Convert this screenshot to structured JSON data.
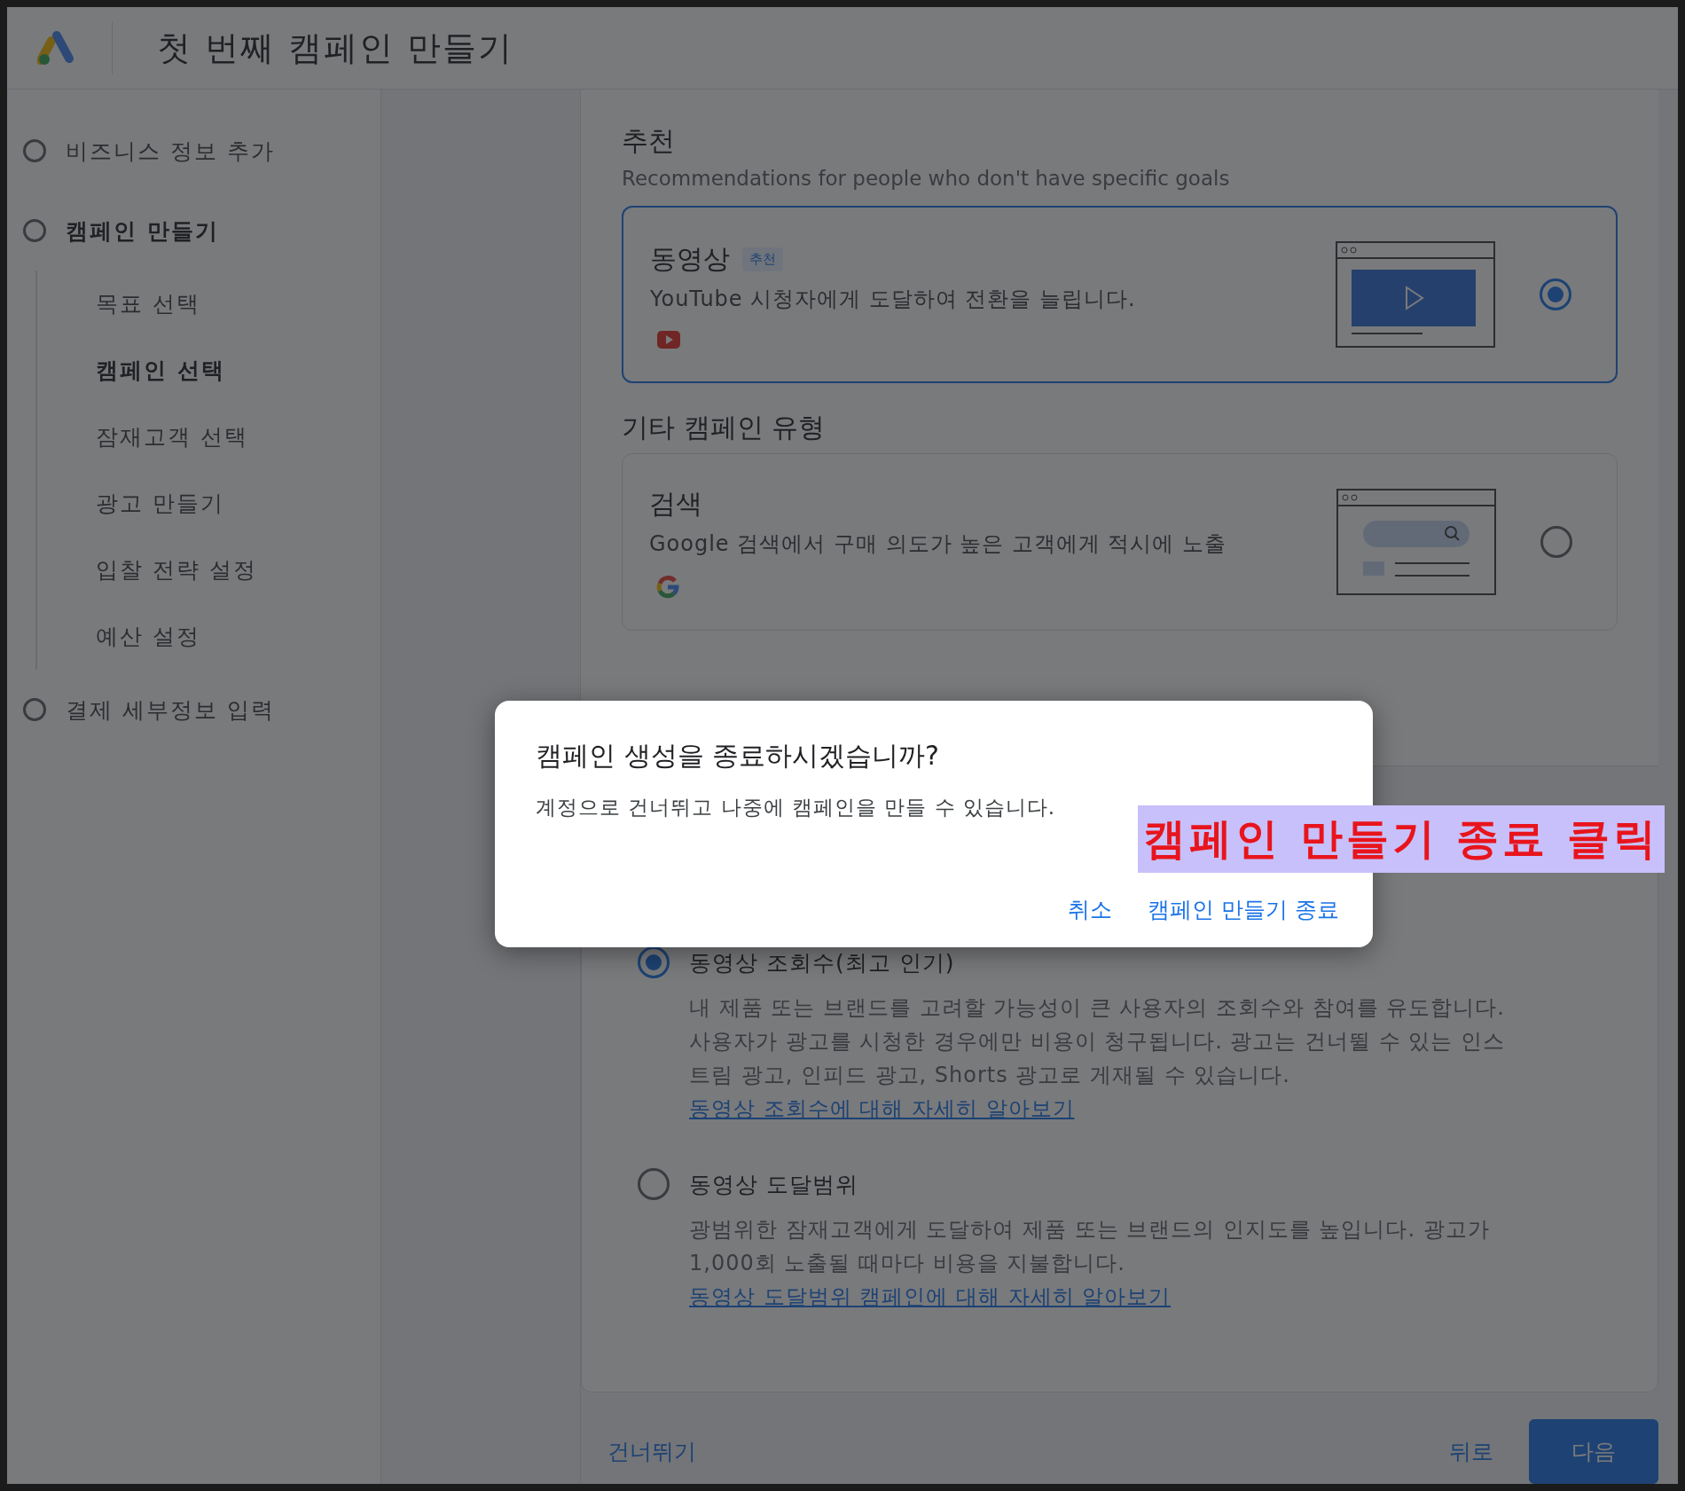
{
  "header": {
    "title": "첫 번째 캠페인 만들기"
  },
  "steps": [
    {
      "label": "비즈니스 정보 추가",
      "selected": false
    },
    {
      "label": "캠페인 만들기",
      "selected": true,
      "children": [
        {
          "label": "목표 선택",
          "selected": false
        },
        {
          "label": "캠페인 선택",
          "selected": true
        },
        {
          "label": "잠재고객 선택",
          "selected": false
        },
        {
          "label": "광고 만들기",
          "selected": false
        },
        {
          "label": "입찰 전략 설정",
          "selected": false
        },
        {
          "label": "예산 설정",
          "selected": false
        }
      ]
    },
    {
      "label": "결제 세부정보 입력",
      "selected": false
    }
  ],
  "recommended": {
    "heading": "추천",
    "subheading": "Recommendations for people who don't have specific goals",
    "cards": [
      {
        "kind": "video",
        "title": "동영상",
        "badge": "추천",
        "description": "YouTube 시청자에게 도달하여 전환을 늘립니다.",
        "selected": true
      }
    ]
  },
  "other": {
    "heading": "기타 캠페인 유형",
    "cards": [
      {
        "kind": "search",
        "title": "검색",
        "description": "Google 검색에서 구매 의도가 높은 고객에게 적시에 노출",
        "selected": false
      }
    ]
  },
  "subtypes": {
    "options": [
      {
        "label": "동영상 조회수(최고 인기)",
        "selected": true,
        "description": "내 제품 또는 브랜드를 고려할 가능성이 큰 사용자의 조회수와 참여를 유도합니다. 사용자가 광고를 시청한 경우에만 비용이 청구됩니다. 광고는 건너뛸 수 있는 인스트림 광고, 인피드 광고, Shorts 광고로 게재될 수 있습니다.",
        "link": "동영상 조회수에 대해 자세히 알아보기"
      },
      {
        "label": "동영상 도달범위",
        "selected": false,
        "description": "광범위한 잠재고객에게 도달하여 제품 또는 브랜드의 인지도를 높입니다. 광고가 1,000회 노출될 때마다 비용을 지불합니다.",
        "link": "동영상 도달범위 캠페인에 대해 자세히 알아보기"
      }
    ]
  },
  "footer": {
    "skip": "건너뛰기",
    "back": "뒤로",
    "next": "다음"
  },
  "dialog": {
    "title": "캠페인 생성을 종료하시겠습니까?",
    "body": "계정으로 건너뛰고 나중에 캠페인을 만들 수 있습니다.",
    "buttons": [
      "취소",
      "캠페인 만들기 종료"
    ]
  },
  "annotation": {
    "text": "캠페인 만들기 종료 클릭"
  }
}
